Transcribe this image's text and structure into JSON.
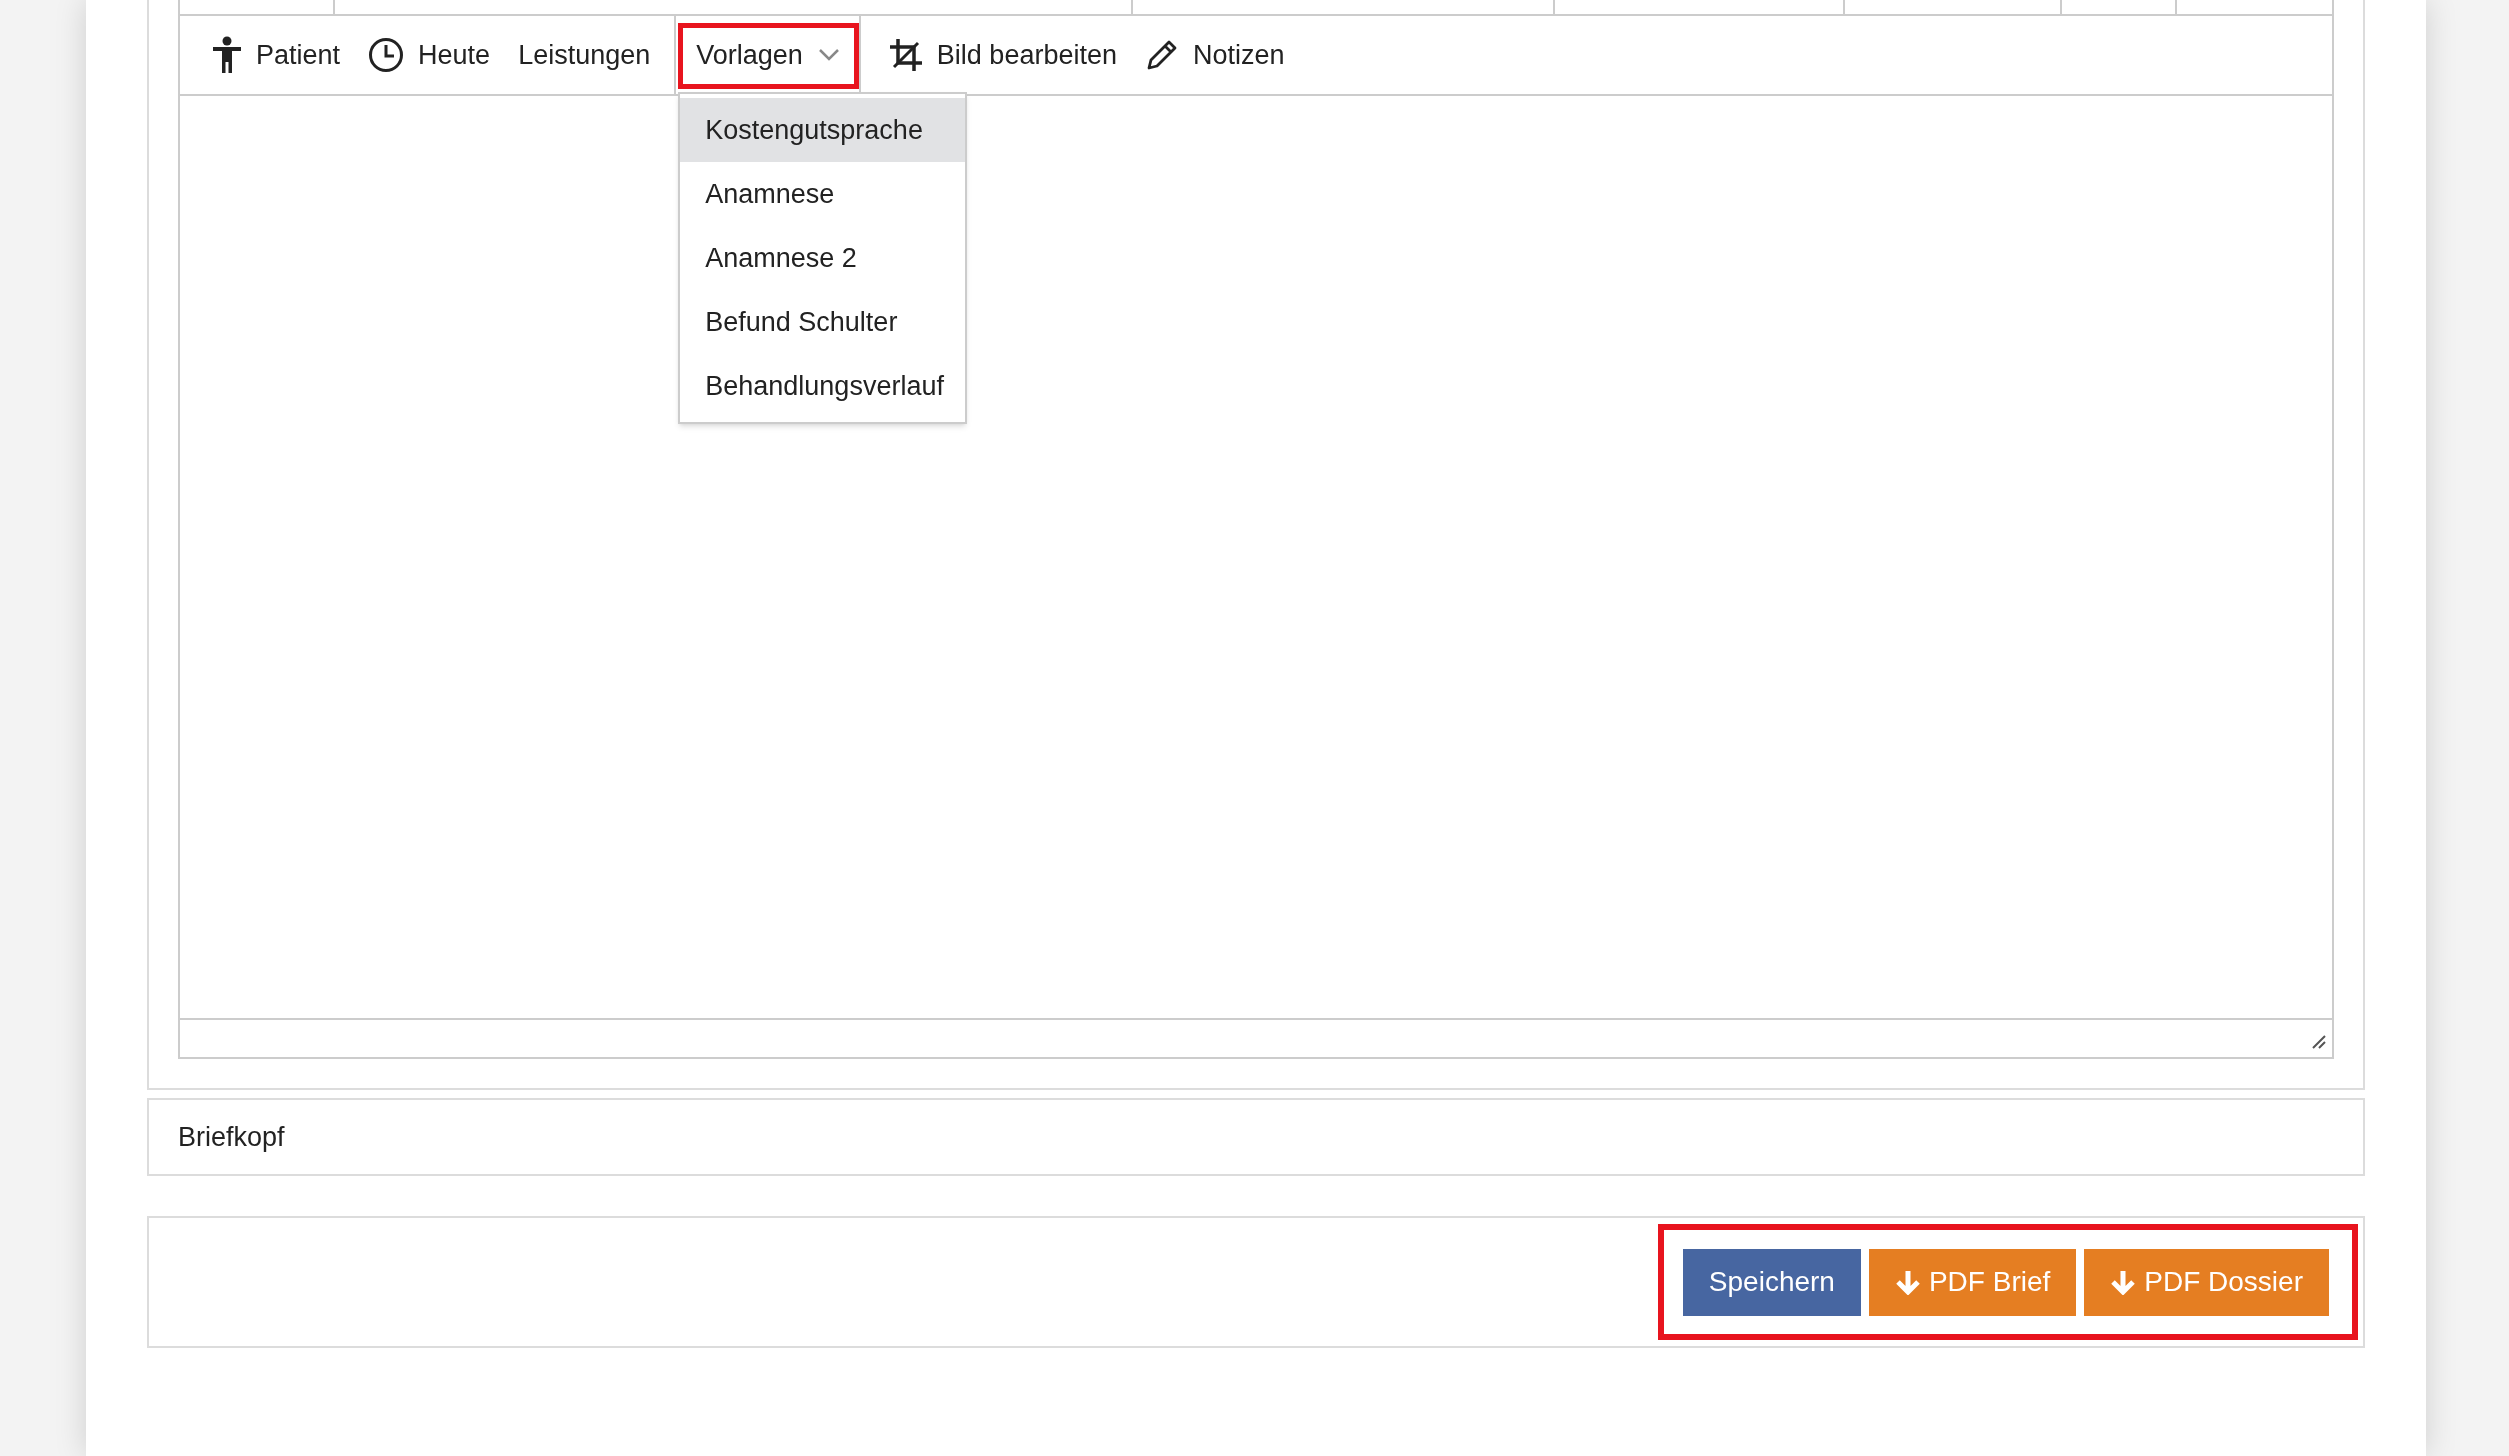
{
  "toolbar": [
    {
      "kind": "button",
      "label": "Patient"
    },
    {
      "kind": "button",
      "label": "Heute"
    },
    {
      "kind": "button",
      "label": "Leistungen"
    },
    {
      "kind": "dropdown",
      "label": "Vorlagen",
      "annotated": true,
      "expanded": true,
      "options": [
        {
          "label": "Kostengutsprache",
          "selected": true
        },
        {
          "label": "Anamnese",
          "selected": false
        },
        {
          "label": "Anamnese 2",
          "selected": false
        },
        {
          "label": "Befund Schulter",
          "selected": false
        },
        {
          "label": "Behandlungsverlauf",
          "selected": false
        }
      ]
    },
    {
      "kind": "button",
      "label": "Bild bearbeiten"
    },
    {
      "kind": "button",
      "label": "Notizen"
    }
  ],
  "letterhead": {
    "label": "Briefkopf"
  },
  "actions": {
    "annotated": true,
    "buttons": [
      {
        "kind": "primary",
        "label": "Speichern"
      },
      {
        "kind": "download",
        "label": "PDF Brief"
      },
      {
        "kind": "download",
        "label": "PDF Dossier"
      }
    ]
  }
}
